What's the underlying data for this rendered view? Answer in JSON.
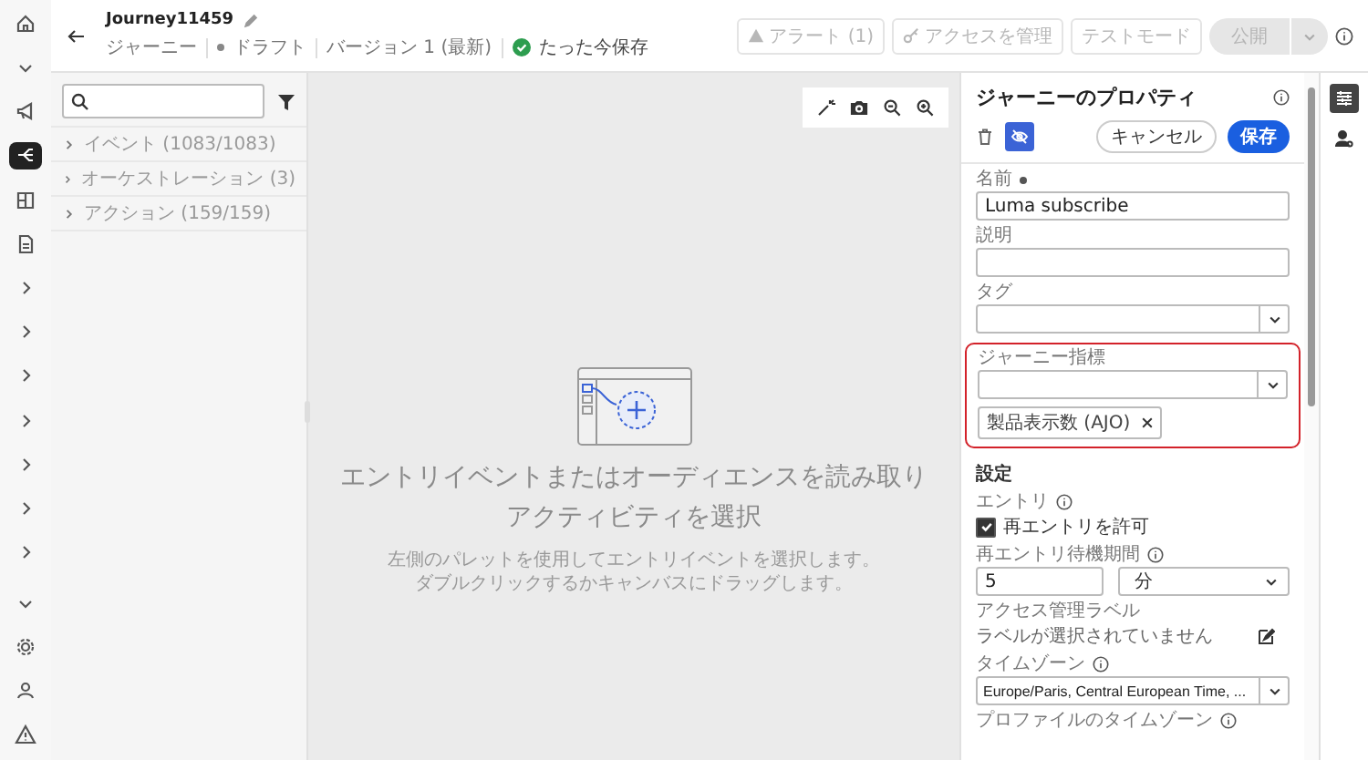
{
  "nav_rail": {
    "items": [
      {
        "kind": "home",
        "selected": false
      },
      {
        "kind": "caret-down",
        "selected": false
      },
      {
        "kind": "megaphone",
        "selected": false
      },
      {
        "kind": "flow",
        "selected": true
      },
      {
        "kind": "layout",
        "selected": false
      },
      {
        "kind": "document",
        "selected": false
      },
      {
        "kind": "caret-right",
        "selected": false
      },
      {
        "kind": "caret-right",
        "selected": false
      },
      {
        "kind": "caret-right",
        "selected": false
      },
      {
        "kind": "caret-right",
        "selected": false
      },
      {
        "kind": "caret-right",
        "selected": false
      },
      {
        "kind": "caret-right",
        "selected": false
      },
      {
        "kind": "caret-right",
        "selected": false
      },
      {
        "kind": "caret-down",
        "selected": false
      },
      {
        "kind": "gear",
        "selected": false
      },
      {
        "kind": "person",
        "selected": false
      },
      {
        "kind": "warning",
        "selected": false
      }
    ]
  },
  "header": {
    "title": "Journey11459",
    "breadcrumbs": [
      {
        "kind": "text",
        "label": "ジャーニー"
      },
      {
        "kind": "status",
        "label": "ドラフト"
      },
      {
        "kind": "text",
        "label": "バージョン 1 (最新)"
      },
      {
        "kind": "saved",
        "label": "たった今保存"
      }
    ],
    "actions": [
      {
        "kind": "alert",
        "label": "アラート (1)",
        "disabled": true
      },
      {
        "kind": "access",
        "label": "アクセスを管理",
        "disabled": true
      },
      {
        "kind": "plain",
        "label": "テストモード",
        "disabled": true
      },
      {
        "kind": "split",
        "label": "公開",
        "disabled": true
      }
    ]
  },
  "palette": {
    "categories": [
      {
        "label": "イベント (1083/1083)",
        "expanded": false
      },
      {
        "label": "オーケストレーション (3)",
        "expanded": false
      },
      {
        "label": "アクション (159/159)",
        "expanded": false
      }
    ]
  },
  "canvas": {
    "tools": [
      {
        "kind": "wand"
      },
      {
        "kind": "camera"
      },
      {
        "kind": "zoom-out"
      },
      {
        "kind": "zoom-in"
      }
    ],
    "empty_title": "エントリイベントまたはオーディエンスを読み取りアクティビティを選択",
    "empty_hint": [
      "左側のパレットを使用してエントリイベントを選択します。",
      "ダブルクリックするかキャンバスにドラッグします。"
    ]
  },
  "properties": {
    "title": "ジャーニーのプロパティ",
    "toggle_selected": true,
    "buttons": [
      {
        "kind": "secondary",
        "label": "キャンセル"
      },
      {
        "kind": "primary",
        "label": "保存"
      }
    ],
    "fields": [
      {
        "kind": "text",
        "label": "名前",
        "required": true,
        "value": "Luma subscribe"
      },
      {
        "kind": "text",
        "label": "説明"
      },
      {
        "kind": "select",
        "label": "タグ"
      },
      {
        "kind": "tag-select",
        "label": "ジャーニー指標",
        "highlighted": true,
        "tags": [
          "製品表示数 (AJO)"
        ]
      },
      {
        "kind": "heading",
        "label": "設定"
      },
      {
        "kind": "checkbox",
        "label": "エントリ",
        "info": true,
        "option": "再エントリを許可",
        "checked": true
      },
      {
        "kind": "duration",
        "label": "再エントリ待機期間",
        "info": true,
        "value": "5",
        "unit": "分"
      },
      {
        "kind": "labels",
        "label": "アクセス管理ラベル",
        "value": "ラベルが選択されていません"
      },
      {
        "kind": "select",
        "label": "タイムゾーン",
        "info": true,
        "value": "Europe/Paris, Central European Time, ..."
      },
      {
        "kind": "label-only",
        "label": "プロファイルのタイムゾーン",
        "info": true
      }
    ]
  },
  "right_rail": {
    "items": [
      {
        "kind": "properties",
        "selected": true
      },
      {
        "kind": "person",
        "selected": false
      }
    ]
  }
}
